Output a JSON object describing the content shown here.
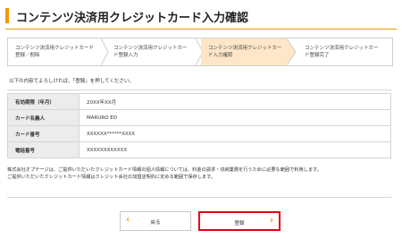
{
  "page": {
    "title": "コンテンツ決済用クレジットカード入力確認",
    "accent_color": "#f39800"
  },
  "steps": [
    {
      "label_line1": "コンテンツ決済用クレジットカード",
      "label_line2": "登録／削除",
      "active": false
    },
    {
      "label_line1": "コンテンツ決済用クレジットカー",
      "label_line2": "ド登録入力",
      "active": false
    },
    {
      "label_line1": "コンテンツ決済用クレジットカー",
      "label_line2": "ド入力確認",
      "active": true
    },
    {
      "label_line1": "コンテンツ決済用クレジットカー",
      "label_line2": "ド登録完了",
      "active": false
    }
  ],
  "instruction": "以下の内容でよろしければ、「登録」を押してください。",
  "info_table": [
    {
      "label": "有効期限（年月）",
      "value": "20XX年XX月"
    },
    {
      "label": "カード名義人",
      "value": "MARURO EO"
    },
    {
      "label": "カード番号",
      "value": "XXXXXX******XXXX"
    },
    {
      "label": "電話番号",
      "value": "XXXXXXXXXXXX"
    }
  ],
  "notice": {
    "line1": "株式会社オプテージは、ご提供いただいたクレジットカード情報の個人情報については、料金の請求・収納業務を行うために必要な範囲で利用します。",
    "line2": "ご提供いただいたクレジットカード情報はクレジット会社の加盟店契約に定める範囲で保存します。"
  },
  "buttons": {
    "back_label": "戻る",
    "register_label": "登録",
    "back_icon": "chevron-left-icon",
    "register_icon": "chevron-right-icon"
  }
}
